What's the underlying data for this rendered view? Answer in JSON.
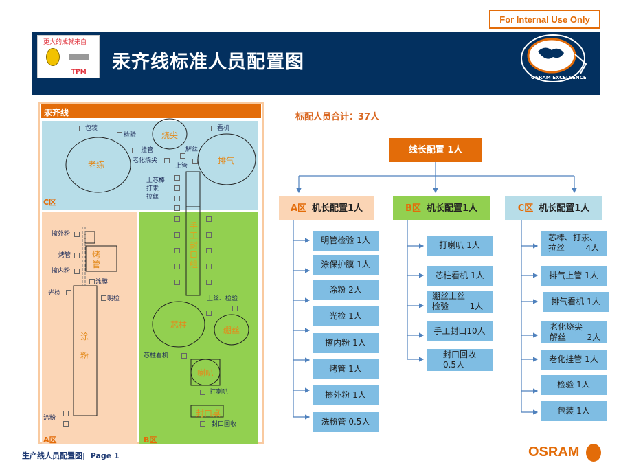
{
  "badge": "For Internal Use Only",
  "header": {
    "title": "汞齐线标准人员配置图",
    "tpm_logo_text": "更大的成就来自",
    "tpm_label": "TPM",
    "excellence_logo": "OSRAM EXCELLENCE"
  },
  "floorplan": {
    "title": "汞齐线",
    "zone_c": {
      "label": "C区",
      "stations": [
        "老练",
        "烧尖",
        "排气"
      ],
      "posts": [
        "包装",
        "检验",
        "看机",
        "挂管",
        "老化烧尖",
        "解丝",
        "上管",
        "上芯棒",
        "打汞",
        "拉丝"
      ]
    },
    "zone_a": {
      "label": "A区",
      "stations": [
        "烤",
        "管",
        "涂",
        "粉"
      ],
      "posts": [
        "擦外粉",
        "烤管",
        "擦内粉",
        "涂膜",
        "光检",
        "明检",
        "涂粉"
      ]
    },
    "zone_b": {
      "label": "B区",
      "stations": [
        "手工封口组",
        "芯柱",
        "绷丝",
        "喇叭",
        "封口桌"
      ],
      "posts": [
        "上丝、检验",
        "芯柱看机",
        "打喇叭",
        "封口回收"
      ]
    }
  },
  "summary": "标配人员合计：37人",
  "org": {
    "root": "线长配置 1人",
    "zones": [
      {
        "zone": "A区",
        "label": "机长配置1人",
        "color": "#fbd5b5",
        "items": [
          "明管检验  1人",
          "涂保护膜  1人",
          "涂粉  2人",
          "光检  1人",
          "擦内粉  1人",
          "烤管  1人",
          "擦外粉  1人",
          "洗粉管  0.5人"
        ]
      },
      {
        "zone": "B区",
        "label": "机长配置1人",
        "color": "#92d050",
        "items": [
          "打喇叭   1人",
          "芯柱看机 1人",
          "绷丝上丝\n检验        1人",
          "手工封口10人",
          "封口回收\n0.5人"
        ]
      },
      {
        "zone": "C区",
        "label": "机长配置1人",
        "color": "#b7dde8",
        "items": [
          "芯棒、打汞、\n拉丝        4人",
          "排气上管 1人",
          "排气看机 1人",
          "老化烧尖\n解丝        2人",
          "老化挂管 1人",
          "检验 1人",
          "包装 1人"
        ]
      }
    ]
  },
  "footer": {
    "text": "生产线人员配置图|",
    "page": "Page 1",
    "brand": "OSRAM"
  },
  "colors": {
    "navy": "#03305f",
    "orange": "#e36c09",
    "item_blue": "#7fbde3",
    "line_blue": "#4f81bd"
  }
}
